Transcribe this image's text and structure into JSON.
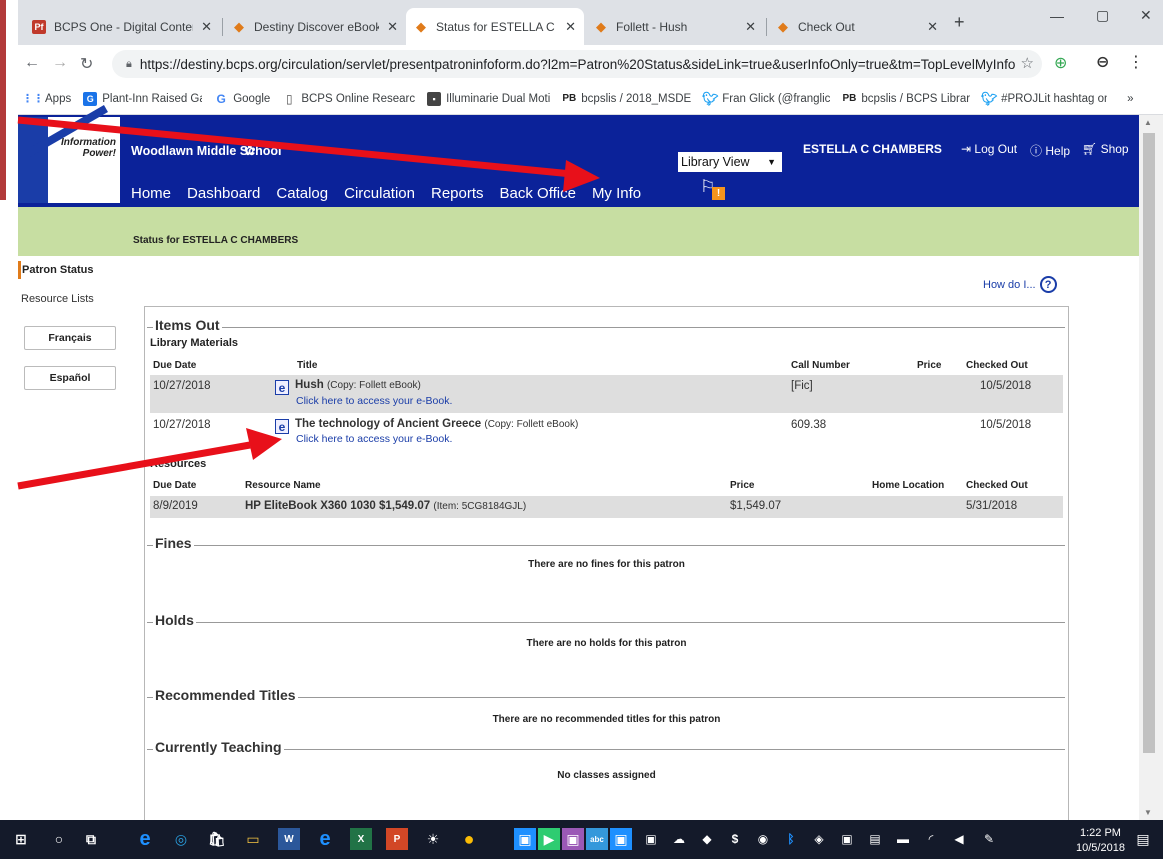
{
  "tabs": [
    {
      "label": "BCPS One - Digital Content",
      "icon": "pf-icon",
      "active": false
    },
    {
      "label": "Destiny Discover eBooks",
      "icon": "destiny-icon",
      "active": false
    },
    {
      "label": "Status for ESTELLA C CHAMB",
      "icon": "destiny-icon",
      "active": true
    },
    {
      "label": "Follett - Hush",
      "icon": "destiny-icon",
      "active": false
    },
    {
      "label": "Check Out",
      "icon": "destiny-icon",
      "active": false
    }
  ],
  "address": {
    "url": "https://destiny.bcps.org/circulation/servlet/presentpatroninfoform.do?l2m=Patron%20Status&sideLink=true&userInfoOnly=true&tm=TopLevelMyInfo"
  },
  "bookmarks": [
    "Apps",
    "Plant-Inn Raised Gar",
    "Google",
    "BCPS Online Researc",
    "Illuminarie Dual Moti",
    "bcpslis / 2018_MSDE",
    "Fran Glick (@franglic",
    "bcpslis / BCPS Librar",
    "#PROJLit hashtag on"
  ],
  "header": {
    "logo_text": "Information Power!",
    "school": "Woodlawn Middle School",
    "view_select": "Library View",
    "user": "ESTELLA C CHAMBERS",
    "logout": "Log Out",
    "help": "Help",
    "shop": "Shop",
    "nav": [
      "Home",
      "Dashboard",
      "Catalog",
      "Circulation",
      "Reports",
      "Back Office",
      "My Info"
    ],
    "alert": "!"
  },
  "status_bar": "Status for ESTELLA C CHAMBERS",
  "sidebar": {
    "patron_status": "Patron Status",
    "resource_lists": "Resource Lists",
    "lang_fr": "Français",
    "lang_es": "Español"
  },
  "how_do_i": "How do I...",
  "items_out": {
    "title": "Items Out",
    "library_materials": "Library Materials",
    "lm_headers": {
      "due": "Due Date",
      "title": "Title",
      "call": "Call Number",
      "price": "Price",
      "checked": "Checked Out"
    },
    "lm_rows": [
      {
        "due": "10/27/2018",
        "title": "Hush",
        "copy": "(Copy: Follett eBook)",
        "link": "Click here to access your e-Book.",
        "call": "[Fic]",
        "price": "",
        "checked": "10/5/2018"
      },
      {
        "due": "10/27/2018",
        "title": "The technology of Ancient Greece",
        "copy": "(Copy: Follett eBook)",
        "link": "Click here to access your e-Book.",
        "call": "609.38",
        "price": "",
        "checked": "10/5/2018"
      }
    ],
    "resources": "Resources",
    "res_headers": {
      "due": "Due Date",
      "name": "Resource Name",
      "price": "Price",
      "home": "Home Location",
      "checked": "Checked Out"
    },
    "res_rows": [
      {
        "due": "8/9/2019",
        "name": "HP EliteBook X360 1030 $1,549.07",
        "item": "(Item: 5CG8184GJL)",
        "price": "$1,549.07",
        "home": "",
        "checked": "5/31/2018"
      }
    ]
  },
  "fines": {
    "title": "Fines",
    "message": "There are no fines for this patron"
  },
  "holds": {
    "title": "Holds",
    "message": "There are no holds for this patron"
  },
  "recommended": {
    "title": "Recommended Titles",
    "message": "There are no recommended titles for this patron"
  },
  "teaching": {
    "title": "Currently Teaching",
    "message": "No classes assigned"
  },
  "taskbar": {
    "time": "1:22 PM",
    "date": "10/5/2018"
  },
  "colors": {
    "header": "#0b2299",
    "green": "#c7dea2",
    "accent": "#e07b1a",
    "arrow": "#e8101a"
  }
}
